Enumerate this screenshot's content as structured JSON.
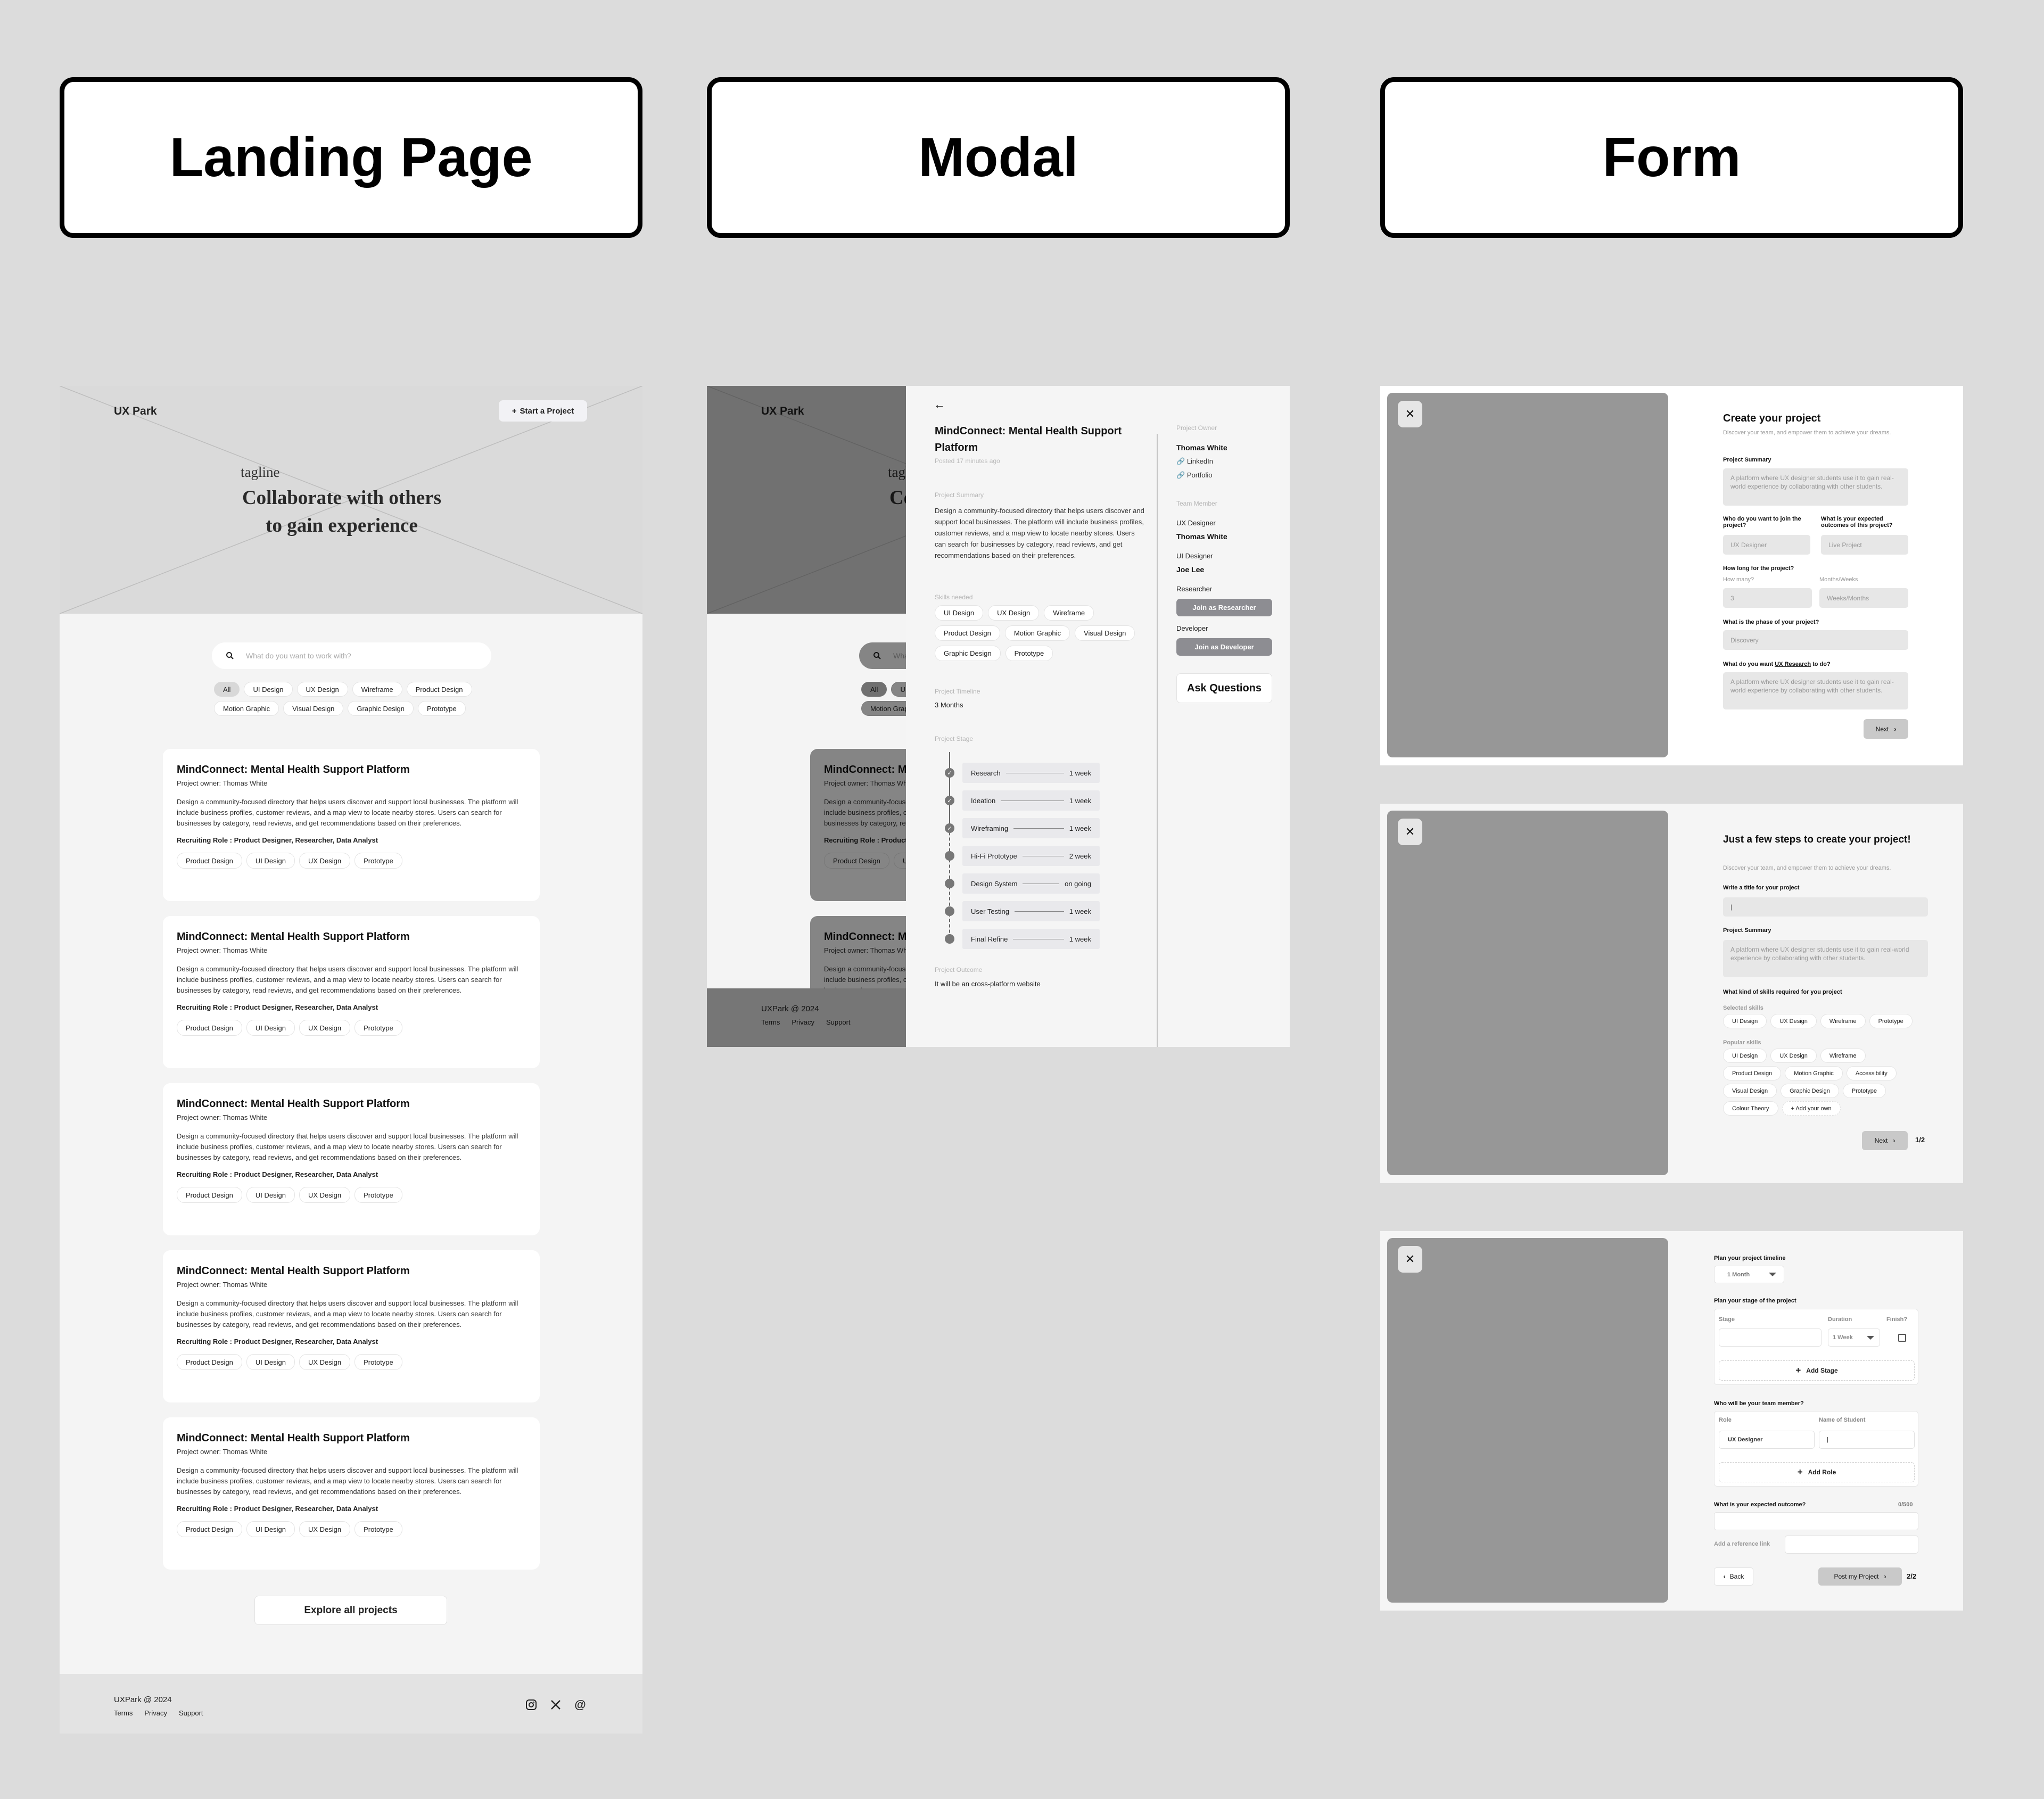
{
  "sections": {
    "landing": "Landing Page",
    "modal": "Modal",
    "form": "Form"
  },
  "landing": {
    "brand": "UX Park",
    "start_button": "Start a Project",
    "tagline": "tagline",
    "hero_title_line1": "Collaborate with others",
    "hero_title_line2": "to gain experience",
    "search_placeholder": "What do you want to work with?",
    "filters": [
      "All",
      "UI Design",
      "UX Design",
      "Wireframe",
      "Product Design",
      "Motion Graphic",
      "Visual Design",
      "Graphic Design",
      "Prototype"
    ],
    "active_filter": "All",
    "cards": [
      {
        "title": "MindConnect: Mental Health Support Platform",
        "owner": "Project owner: Thomas White",
        "description": "Design a community-focused directory that helps users discover and support local businesses. The platform will include business profiles, customer reviews, and a map view to locate nearby stores. Users can search for businesses by category, read reviews, and get recommendations based on their preferences.",
        "roles": "Recruiting Role : Product Designer, Researcher,  Data Analyst",
        "tags": [
          "Product Design",
          "UI Design",
          "UX Design",
          "Prototype"
        ]
      },
      {
        "title": "MindConnect: Mental Health Support Platform",
        "owner": "Project owner: Thomas White",
        "description": "Design a community-focused directory that helps users discover and support local businesses. The platform will include business profiles, customer reviews, and a map view to locate nearby stores. Users can search for businesses by category, read reviews, and get recommendations based on their preferences.",
        "roles": "Recruiting Role : Product Designer, Researcher,  Data Analyst",
        "tags": [
          "Product Design",
          "UI Design",
          "UX Design",
          "Prototype"
        ]
      },
      {
        "title": "MindConnect: Mental Health Support Platform",
        "owner": "Project owner: Thomas White",
        "description": "Design a community-focused directory that helps users discover and support local businesses. The platform will include business profiles, customer reviews, and a map view to locate nearby stores. Users can search for businesses by category, read reviews, and get recommendations based on their preferences.",
        "roles": "Recruiting Role : Product Designer, Researcher,  Data Analyst",
        "tags": [
          "Product Design",
          "UI Design",
          "UX Design",
          "Prototype"
        ]
      },
      {
        "title": "MindConnect: Mental Health Support Platform",
        "owner": "Project owner: Thomas White",
        "description": "Design a community-focused directory that helps users discover and support local businesses. The platform will include business profiles, customer reviews, and a map view to locate nearby stores. Users can search for businesses by category, read reviews, and get recommendations based on their preferences.",
        "roles": "Recruiting Role : Product Designer, Researcher,  Data Analyst",
        "tags": [
          "Product Design",
          "UI Design",
          "UX Design",
          "Prototype"
        ]
      },
      {
        "title": "MindConnect: Mental Health Support Platform",
        "owner": "Project owner: Thomas White",
        "description": "Design a community-focused directory that helps users discover and support local businesses. The platform will include business profiles, customer reviews, and a map view to locate nearby stores. Users can search for businesses by category, read reviews, and get recommendations based on their preferences.",
        "roles": "Recruiting Role : Product Designer, Researcher,  Data Analyst",
        "tags": [
          "Product Design",
          "UI Design",
          "UX Design",
          "Prototype"
        ]
      }
    ],
    "explore_button": "Explore all projects",
    "footer": {
      "copyright": "UXPark @ 2024",
      "links": [
        "Terms",
        "Privacy",
        "Support"
      ],
      "socials": [
        "instagram-icon",
        "x-icon",
        "threads-icon"
      ]
    }
  },
  "modal": {
    "title": "MindConnect: Mental Health Support Platform",
    "posted": "Posted 17 minutes ago",
    "summary_label": "Project Summary",
    "summary": "Design a community-focused directory that helps users discover and support local businesses. The platform will include business profiles, customer reviews, and a map view to locate nearby stores. Users can search for businesses by category, read reviews, and get recommendations based on their preferences.",
    "skills_label": "Skills needed",
    "skills": [
      "UI Design",
      "UX Design",
      "Wireframe",
      "Product Design",
      "Motion Graphic",
      "Visual Design",
      "Graphic Design",
      "Prototype"
    ],
    "timeline_label": "Project Timeline",
    "timeline_value": "3 Months",
    "stage_label": "Project Stage",
    "stages": [
      {
        "name": "Research",
        "duration": "1 week",
        "done": true
      },
      {
        "name": "Ideation",
        "duration": "1 week",
        "done": true
      },
      {
        "name": "Wireframing",
        "duration": "1 week",
        "done": true
      },
      {
        "name": "Hi-Fi Prototype",
        "duration": "2 week",
        "done": false
      },
      {
        "name": "Design System",
        "duration": "on going",
        "done": false
      },
      {
        "name": "User Testing",
        "duration": "1 week",
        "done": false
      },
      {
        "name": "Final Refine",
        "duration": "1 week",
        "done": false
      }
    ],
    "outcome_label": "Project Outcome",
    "outcome": "It will be an cross-platform website",
    "owner_label": "Project Owner",
    "owner_name": "Thomas White",
    "owner_links": [
      "LinkedIn",
      "Portfolio"
    ],
    "team_label": "Team Member",
    "team": [
      {
        "role": "UX Designer",
        "name": "Thomas White"
      },
      {
        "role": "UI Designer",
        "name": "Joe Lee"
      }
    ],
    "open_roles": [
      {
        "role": "Researcher",
        "button": "Join as Researcher"
      },
      {
        "role": "Developer",
        "button": "Join as Developer"
      }
    ],
    "ask_button": "Ask Questions"
  },
  "form1": {
    "title": "Create your project",
    "subtitle": "Discover your team, and empower them to achieve your dreams.",
    "summary_label": "Project Summary",
    "summary_placeholder": "A platform where UX designer students use it to gain real-world experience by collaborating with other students.",
    "join_label": "Who do you want to join the project?",
    "join_placeholder": "UX Designer",
    "outcome_label": "What is your expected outcomes of this project?",
    "outcome_placeholder": "Live Project",
    "duration_label": "How long for the project?",
    "how_many_label": "How many?",
    "how_many_placeholder": "3",
    "unit_label": "Months/Weeks",
    "unit_placeholder": "Weeks/Months",
    "phase_label": "What is the phase of your project?",
    "phase_placeholder": "Discovery",
    "research_label_pre": "What do you want ",
    "research_label_link": "UX Research",
    "research_label_post": " to do?",
    "research_placeholder": "A platform where UX designer students use it to gain real-world experience by collaborating with other students.",
    "next_button": "Next"
  },
  "form2": {
    "title": "Just a few steps to create your project!",
    "subtitle": "Discover your team, and empower them to achieve your dreams.",
    "title_label": "Write a title for your project",
    "title_value": "",
    "summary_label": "Project Summary",
    "summary_placeholder": "A platform where UX designer students use it to gain real-world experience by collaborating with other students.",
    "skills_label": "What kind of skills required for you project",
    "selected_label": "Selected skills",
    "selected": [
      "UI Design",
      "UX Design",
      "Wireframe",
      "Prototype"
    ],
    "popular_label": "Popular skills",
    "popular": [
      "UI Design",
      "UX Design",
      "Wireframe",
      "Product Design",
      "Motion Graphic",
      "Accessibility",
      "Visual Design",
      "Graphic Design",
      "Prototype",
      "Colour Theory"
    ],
    "add_own": "+ Add your own",
    "next_button": "Next",
    "page": "1/2"
  },
  "form3": {
    "timeline_label": "Plan your project timeline",
    "timeline_value": "1 Month",
    "stage_label": "Plan your stage of the project",
    "stage_col": "Stage",
    "duration_col": "Duration",
    "finish_col": "Finish?",
    "stage_value": "",
    "duration_value": "1 Week",
    "finished": false,
    "add_stage": "Add Stage",
    "team_label": "Who will be your team member?",
    "role_col": "Role",
    "student_col": "Name of Student",
    "role_value": "UX Designer",
    "student_value": "",
    "add_role": "Add Role",
    "outcome_label": "What is your expected outcome?",
    "outcome_counter": "0/500",
    "outcome_value": "",
    "ref_label": "Add a reference link",
    "ref_value": "",
    "back_button": "Back",
    "post_button": "Post my Project",
    "page": "2/2"
  }
}
